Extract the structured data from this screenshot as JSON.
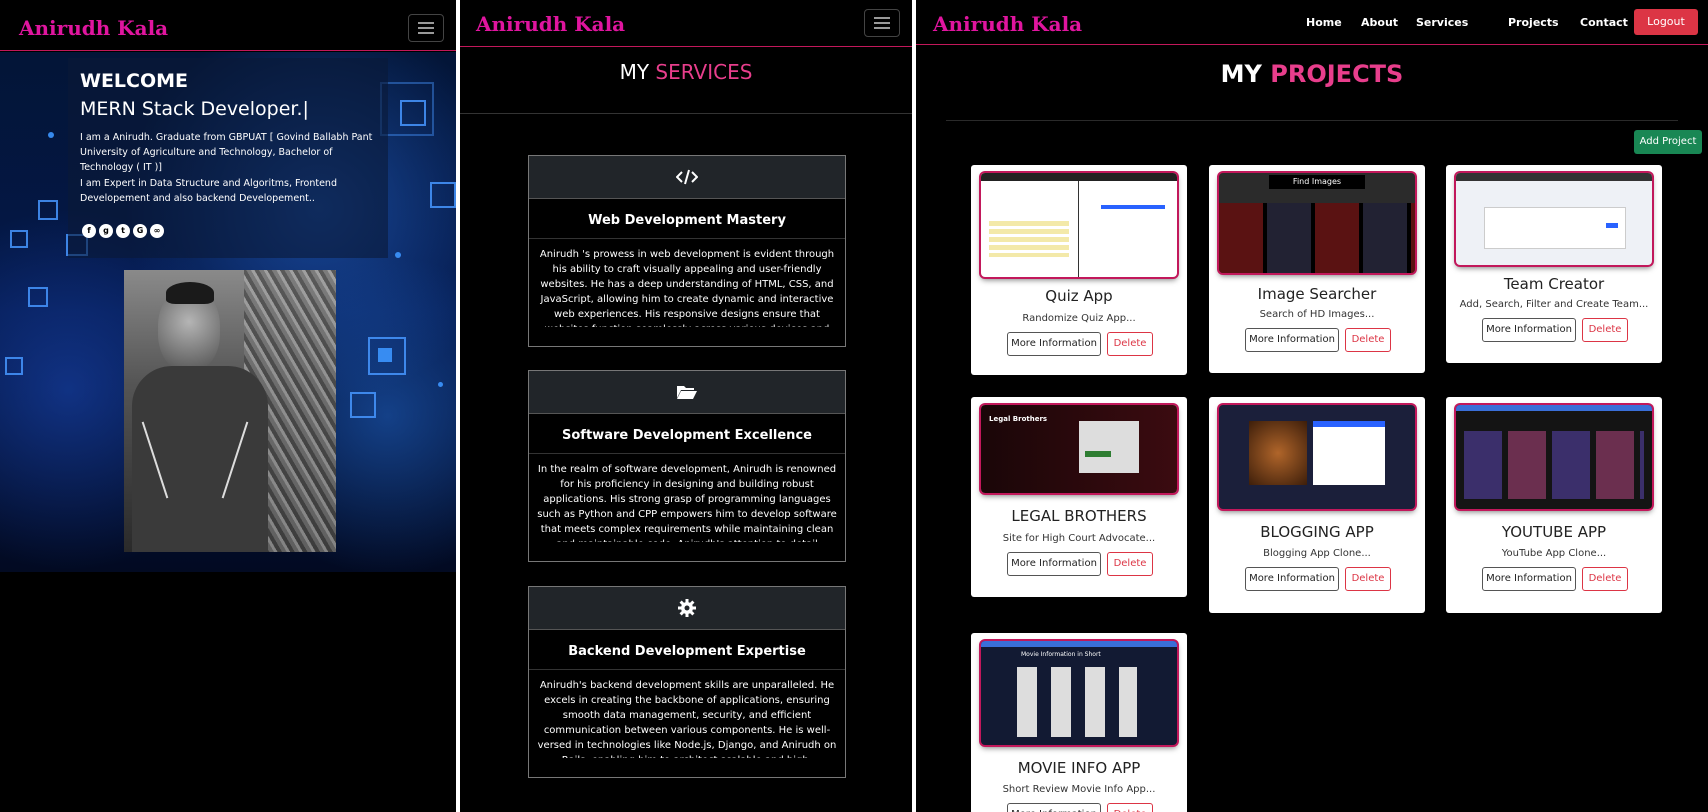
{
  "brand": "Anirudh Kala",
  "hero": {
    "welcome": "WELCOME",
    "role": "MERN Stack Developer.|",
    "para1": "I am a Anirudh. Graduate from GBPUAT [ Govind Ballabh Pant University of Agriculture and Technology, Bachelor of Technology ( IT )]",
    "para2": "I am Expert in Data Structure and Algoritms, Frontend Developement and also backend Developement..",
    "social_icons": [
      "facebook-icon",
      "github-icon",
      "twitter-icon",
      "google-icon",
      "other-icon"
    ]
  },
  "services": {
    "heading_a": "MY",
    "heading_b": "SERVICES",
    "cards": [
      {
        "icon": "code-icon",
        "title": "Web Development Mastery",
        "text": "Anirudh 's prowess in web development is evident through his ability to craft visually appealing and user-friendly websites. He has a deep understanding of HTML, CSS, and JavaScript, allowing him to create dynamic and interactive web experiences. His responsive designs ensure that websites function seamlessly across various devices and"
      },
      {
        "icon": "folder-open-icon",
        "title": "Software Development Excellence",
        "text": "In the realm of software development, Anirudh is renowned for his proficiency in designing and building robust applications. His strong grasp of programming languages such as Python and CPP empowers him to develop software that meets complex requirements while maintaining clean and maintainable code. Anirudh's attention to detail"
      },
      {
        "icon": "gear-icon",
        "title": "Backend Development Expertise",
        "text": "Anirudh's backend development skills are unparalleled. He excels in creating the backbone of applications, ensuring smooth data management, security, and efficient communication between various components. He is well-versed in technologies like Node.js, Django, and Anirudh on Rails, enabling him to architect scalable and high-"
      }
    ]
  },
  "nav": {
    "home": "Home",
    "about": "About",
    "services": "Services",
    "projects": "Projects",
    "contact": "Contact",
    "logout": "Logout"
  },
  "projects": {
    "heading_a": "MY",
    "heading_b": "PROJECTS",
    "add_label": "Add Project",
    "more_label": "More Information",
    "delete_label": "Delete",
    "items": [
      {
        "title": "Quiz App",
        "desc": "Randomize Quiz App..."
      },
      {
        "title": "Image Searcher",
        "desc": "Search of HD Images...",
        "thumb_text": "Find Images"
      },
      {
        "title": "Team Creator",
        "desc": "Add, Search, Filter and Create Team..."
      },
      {
        "title": "LEGAL BROTHERS",
        "desc": "Site for High Court Advocate...",
        "thumb_text": "Legal Brothers"
      },
      {
        "title": "BLOGGING APP",
        "desc": "Blogging App Clone..."
      },
      {
        "title": "YOUTUBE APP",
        "desc": "YouTube App Clone..."
      },
      {
        "title": "MOVIE INFO APP",
        "desc": "Short Review Movie Info App...",
        "thumb_text": "Movie Information in Short"
      }
    ]
  },
  "colors": {
    "accent": "#e0159f",
    "pink": "#e83e8c",
    "logout": "#dc3545",
    "add": "#198754"
  }
}
